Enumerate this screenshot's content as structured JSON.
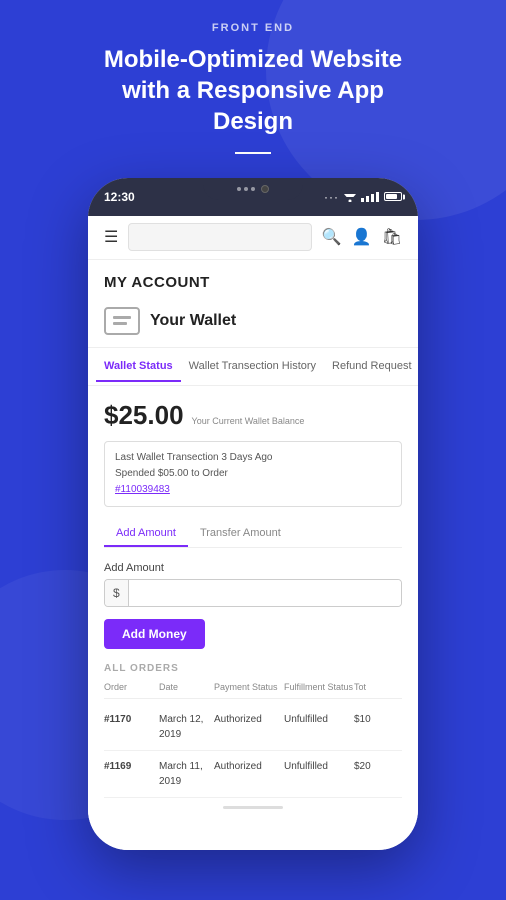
{
  "header": {
    "top_label": "FRONT END",
    "main_title": "Mobile-Optimized Website with a Responsive App Design",
    "divider": true
  },
  "phone": {
    "time": "12:30",
    "nav": {
      "search_placeholder": "",
      "icons": [
        "search",
        "person",
        "shopping-bag"
      ]
    },
    "account": {
      "section_title": "MY ACCOUNT",
      "wallet_label": "Your Wallet"
    },
    "tabs": [
      {
        "label": "Wallet Status",
        "active": true
      },
      {
        "label": "Wallet Transection History",
        "active": false
      },
      {
        "label": "Refund Request",
        "active": false
      }
    ],
    "wallet_status": {
      "balance": "$25.00",
      "balance_label": "Your Current Wallet Balance",
      "last_transaction": "Last Wallet Transection 3 Days Ago",
      "spent_text": "Spended $05.00 to Order",
      "order_link": "#110039483",
      "sub_tabs": [
        {
          "label": "Add Amount",
          "active": true
        },
        {
          "label": "Transfer Amount",
          "active": false
        }
      ],
      "add_amount_label": "Add Amount",
      "input_prefix": "$",
      "input_placeholder": "",
      "add_button_label": "Add Money"
    },
    "orders": {
      "section_title": "ALL ORDERS",
      "headers": [
        "Order",
        "Date",
        "Payment Status",
        "Fulfillment Status",
        "Tot"
      ],
      "rows": [
        {
          "order_id": "#1170",
          "date": "March 12, 2019",
          "payment_status": "Authorized",
          "fulfillment_status": "Unfulfilled",
          "total": "$10"
        },
        {
          "order_id": "#1169",
          "date": "March 11, 2019",
          "payment_status": "Authorized",
          "fulfillment_status": "Unfulfilled",
          "total": "$20"
        }
      ]
    }
  }
}
